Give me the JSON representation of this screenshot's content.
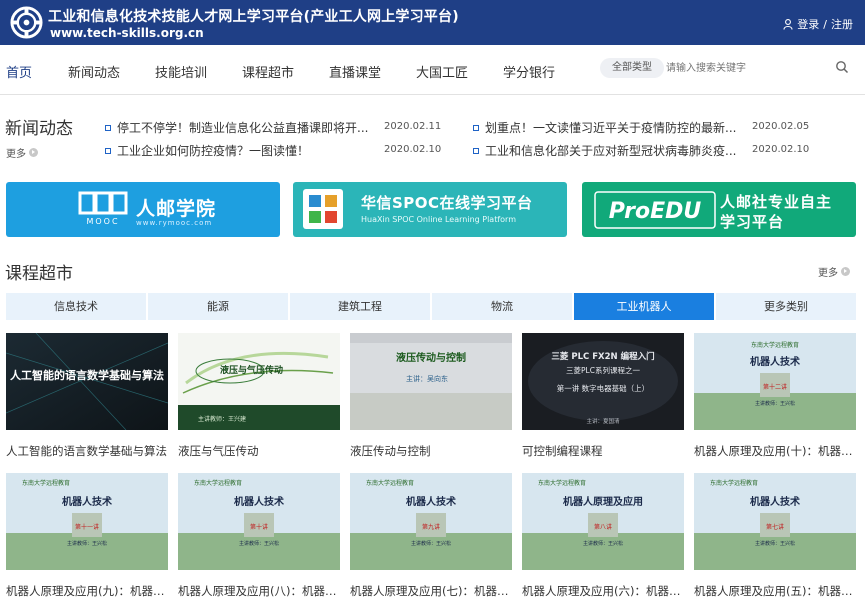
{
  "header": {
    "title": "工业和信息化技术技能人才网上学习平台(产业工人网上学习平台)",
    "url": "www.tech-skills.org.cn",
    "login": "登录",
    "separator": "/",
    "register": "注册"
  },
  "nav": {
    "items": [
      "首页",
      "新闻动态",
      "技能培训",
      "课程超市",
      "直播课堂",
      "大国工匠",
      "学分银行"
    ],
    "active": "首页",
    "search": {
      "type_label": "全部类型",
      "placeholder": "请输入搜索关键字"
    }
  },
  "news": {
    "title": "新闻动态",
    "more": "更多",
    "items": [
      {
        "text": "停工不停学！制造业信息化公益直播课即将开...",
        "date": "2020.02.11"
      },
      {
        "text": "划重点！一文读懂习近平关于疫情防控的最新...",
        "date": "2020.02.05"
      },
      {
        "text": "工业企业如何防控疫情？一图读懂！",
        "date": "2020.02.10"
      },
      {
        "text": "工业和信息化部关于应对新型冠状病毒肺炎疫...",
        "date": "2020.02.10"
      }
    ]
  },
  "banners": {
    "b1": {
      "title": "人邮学院",
      "sub": "www.rymooc.com",
      "logo_text": "MOOC"
    },
    "b2": {
      "title": "华信SPOC在线学习平台",
      "sub": "HuaXin SPOC Online Learning Platform"
    },
    "b3": {
      "logo": "ProEDU",
      "line1": "人邮社专业自主",
      "line2": "学习平台"
    }
  },
  "courses": {
    "title": "课程超市",
    "more": "更多",
    "tabs": [
      "信息技术",
      "能源",
      "建筑工程",
      "物流",
      "工业机器人",
      "更多类别"
    ],
    "active_tab": "工业机器人",
    "thumbs": {
      "t0": "人工智能的语言数学基础与算法",
      "t1": "液压与气压传动",
      "t1_lecturer": "主讲教师：王兴建",
      "t2": "液压传动与控制",
      "t2_lecturer": "主讲：吴向东",
      "t3_line1": "三菱 PLC FX2N 编程入门",
      "t3_line2": "三菱PLC系列课程之一",
      "t3_line3": "第一讲  数字电器基础（上）",
      "t3_lecturer": "主讲：夏国清",
      "uni": "东南大学远程教育",
      "robot_title": "机器人技术",
      "robot_title2": "机器人原理及应用",
      "lecturer": "主讲教师：王兴松",
      "lessons": [
        "第十二讲",
        "第十一讲",
        "第十讲",
        "第九讲",
        "第八讲",
        "第七讲"
      ]
    },
    "items": [
      "人工智能的语言数学基础与算法",
      "液压与气压传动",
      "液压传动与控制",
      "可控制编程课程",
      "机器人原理及应用(十)：机器人技术",
      "机器人原理及应用(九)：机器人技术",
      "机器人原理及应用(八)：机器人技术",
      "机器人原理及应用(七)：机器人技术",
      "机器人原理及应用(六)：机器人技术",
      "机器人原理及应用(五)：机器人技术"
    ]
  },
  "colors": {
    "header_bg": "#1f3f86",
    "accent": "#1a7fe0",
    "tab_bg": "#e8f2fb"
  }
}
